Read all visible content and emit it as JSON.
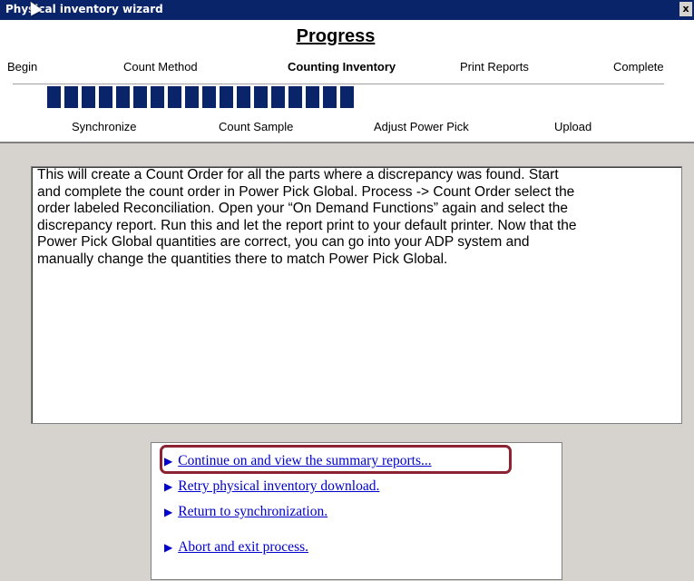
{
  "window": {
    "title": "Physical inventory wizard",
    "close": "x"
  },
  "progress": {
    "heading": "Progress",
    "steps": [
      "Begin",
      "Count Method",
      "Counting Inventory",
      "Print Reports",
      "Complete"
    ],
    "substeps": [
      "Synchronize",
      "Count Sample",
      "Adjust Power Pick",
      "Upload"
    ],
    "bar_segments_filled": 18
  },
  "instructions": {
    "lines": [
      "This will create a Count Order for all the parts where a discrepancy was found.  Start",
      "and complete the count order in Power Pick Global. Process -> Count Order select the",
      "order labeled Reconciliation. Open your “On Demand Functions” again and select the",
      "discrepancy report. Run this and let the report print to your default printer. Now that the",
      "Power Pick Global quantities are correct, you can go into your ADP system and",
      "manually change the quantities there to match Power Pick Global."
    ]
  },
  "actions": [
    {
      "arrow": "▶",
      "label": "Continue on and view the summary reports..."
    },
    {
      "arrow": "▶",
      "label": "Retry physical inventory download."
    },
    {
      "arrow": "▶",
      "label": "Return to synchronization."
    },
    {
      "arrow": "▶",
      "label": "Abort and exit process."
    }
  ]
}
